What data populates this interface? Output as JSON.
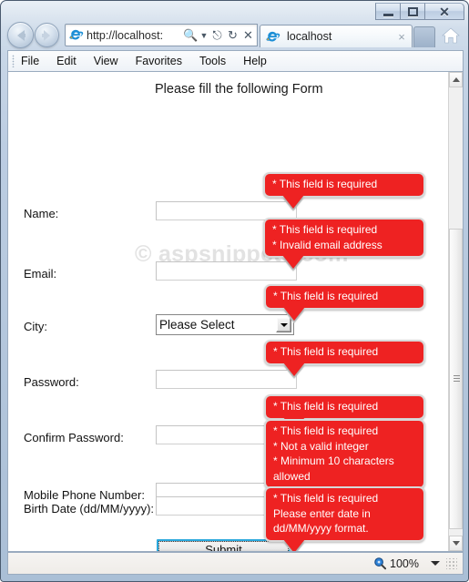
{
  "window": {
    "minimize_label": "Minimize",
    "restore_label": "Restore",
    "close_label": "Close"
  },
  "browser": {
    "back_label": "Back",
    "forward_label": "Forward",
    "address_value": "http://localhost:",
    "address_placeholder": "http://localhost:",
    "address_icons": [
      "search-icon",
      "dropdown-caret-icon",
      "compatibility-view-icon",
      "refresh-icon",
      "stop-icon"
    ],
    "tab_title": "localhost",
    "tab_close_label": "×",
    "home_label": "Home",
    "menu_items": [
      "File",
      "Edit",
      "View",
      "Favorites",
      "Tools",
      "Help"
    ]
  },
  "page": {
    "title": "Please fill the following Form",
    "watermark": "© aspsnippets.com",
    "fields": [
      {
        "label": "Name:",
        "type": "text"
      },
      {
        "label": "Email:",
        "type": "text"
      },
      {
        "label": "City:",
        "type": "select",
        "value": "Please Select"
      },
      {
        "label": "Password:",
        "type": "text"
      },
      {
        "label": "Confirm Password:",
        "type": "text"
      },
      {
        "label": "Mobile Phone Number:",
        "type": "text"
      },
      {
        "label": "Birth Date (dd/MM/yyyy):",
        "type": "text"
      }
    ],
    "validation_tooltips": [
      {
        "for": "Name",
        "text": "* This field is required"
      },
      {
        "for": "Email",
        "text": "* This field is required\n* Invalid email address"
      },
      {
        "for": "City",
        "text": "* This field is required"
      },
      {
        "for": "Password",
        "text": "* This field is required"
      },
      {
        "for": "Confirm Password",
        "text": "* This field is required"
      },
      {
        "for": "Mobile Phone Number",
        "text": "* This field is required\n* Not a valid integer\n* Minimum 10 characters allowed"
      },
      {
        "for": "Birth Date",
        "text": "* This field is required\nPlease enter date in\ndd/MM/yyyy format."
      }
    ],
    "submit_label": "Submit"
  },
  "statusbar": {
    "zoom_icon": "zoom-magnifier-icon",
    "zoom_level": "100%"
  },
  "colors": {
    "error_red": "#ee2222",
    "focus_blue": "#2aa8dd",
    "watermark_gray": "#e2e2e2"
  }
}
